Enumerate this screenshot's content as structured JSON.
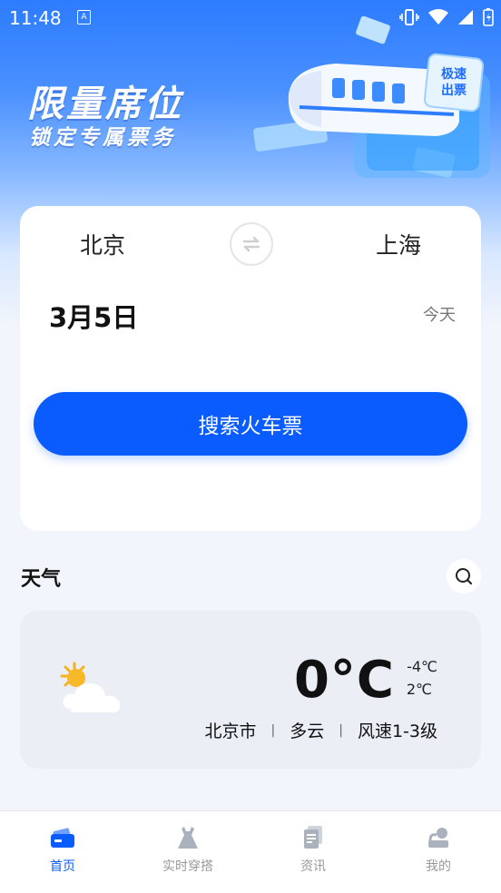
{
  "status_bar": {
    "time": "11:48",
    "app_badge": "A"
  },
  "banner": {
    "title": "限量席位",
    "subtitle": "锁定专属票务",
    "tag_line1": "极速",
    "tag_line2": "出票"
  },
  "ticket_search": {
    "from_city": "北京",
    "to_city": "上海",
    "date": "3月5日",
    "day_label": "今天",
    "search_button": "搜索火车票"
  },
  "weather": {
    "section_title": "天气",
    "temperature": "0°C",
    "temp_low": "-4℃",
    "temp_high": "2℃",
    "city": "北京市",
    "condition": "多云",
    "wind": "风速1-3级",
    "separator": "|"
  },
  "bottom_nav": {
    "items": [
      {
        "label": "首页",
        "icon": "ticket-icon",
        "active": true
      },
      {
        "label": "实时穿搭",
        "icon": "dress-icon",
        "active": false
      },
      {
        "label": "资讯",
        "icon": "news-icon",
        "active": false
      },
      {
        "label": "我的",
        "icon": "profile-icon",
        "active": false
      }
    ]
  },
  "colors": {
    "accent": "#0a5cff",
    "banner_blue": "#2d7cff",
    "inactive": "#999999"
  }
}
